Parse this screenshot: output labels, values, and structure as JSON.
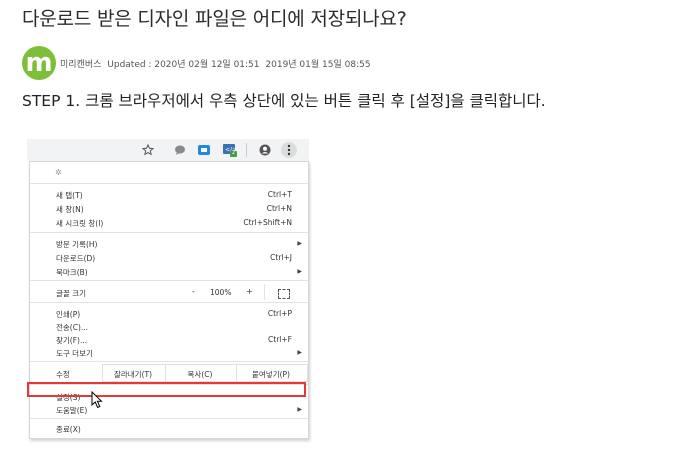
{
  "page": {
    "title": "다운로드 받은 디자인 파일은 어디에 저장되나요?",
    "avatar_letter": "m",
    "author": "미리캔버스",
    "updated_label": "Updated : 2020년 02월 12일 01:51",
    "created": "2019년 01월 15일 08:55",
    "step1": "STEP 1. 크롬 브라우저에서 우측 상단에 있는 버튼 클릭 후 [설정]을 클릭합니다.",
    "accent_color": "#7dbf3a",
    "highlight_color": "#e53935"
  },
  "chrome": {
    "toolbar_icons": [
      "star-icon",
      "chat-icon",
      "extension-icon",
      "code-extension-icon",
      "account-icon",
      "more-menu-icon"
    ],
    "extension_badge": "2",
    "menu": {
      "new_tab": "새 탭(T)",
      "new_tab_sc": "Ctrl+T",
      "new_window": "새 창(N)",
      "new_window_sc": "Ctrl+N",
      "new_incognito": "새 시크릿 창(I)",
      "new_incognito_sc": "Ctrl+Shift+N",
      "history": "방문 기록(H)",
      "downloads": "다운로드(D)",
      "downloads_sc": "Ctrl+J",
      "bookmarks": "북마크(B)",
      "zoom_label": "글꼴 크기",
      "zoom_minus": "-",
      "zoom_value": "100%",
      "zoom_plus": "+",
      "print": "인쇄(P)",
      "print_sc": "Ctrl+P",
      "cast": "전송(C)...",
      "find": "찾기(F)...",
      "find_sc": "Ctrl+F",
      "more_tools": "도구 더보기",
      "edit_label": "수정",
      "cut": "잘라내기(T)",
      "copy": "복사(C)",
      "paste": "붙여넣기(P)",
      "settings": "설정(S)",
      "help": "도움말(E)",
      "exit": "종료(X)"
    }
  }
}
